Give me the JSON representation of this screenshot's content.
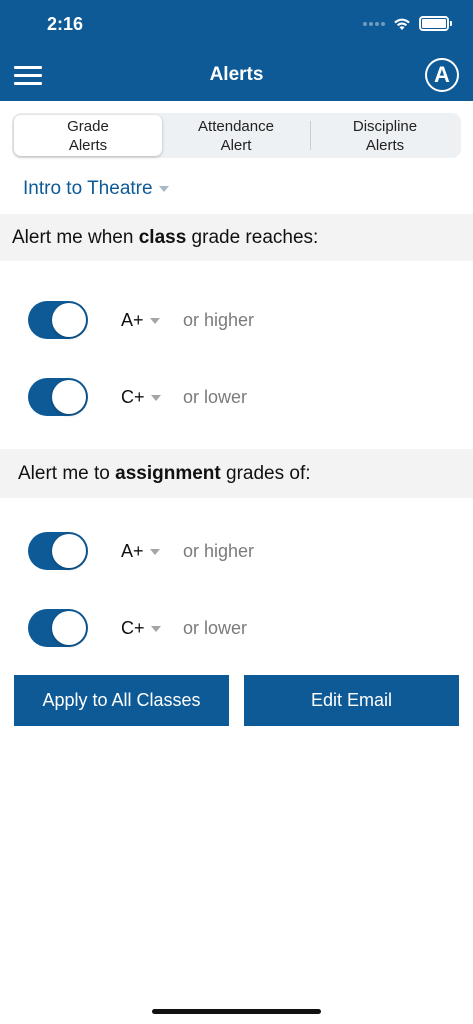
{
  "status_bar": {
    "time": "2:16"
  },
  "header": {
    "title": "Alerts",
    "account_initial": "A"
  },
  "tabs": [
    {
      "line1": "Grade",
      "line2": "Alerts",
      "active": true
    },
    {
      "line1": "Attendance",
      "line2": "Alert",
      "active": false
    },
    {
      "line1": "Discipline",
      "line2": "Alerts",
      "active": false
    }
  ],
  "class_selector": {
    "value": "Intro to Theatre"
  },
  "class_section": {
    "prefix": "Alert me when ",
    "bold": "class",
    "suffix": " grade reaches:",
    "rows": [
      {
        "grade": "A+",
        "condition": "or higher",
        "enabled": true
      },
      {
        "grade": "C+",
        "condition": "or lower",
        "enabled": true
      }
    ]
  },
  "assignment_section": {
    "prefix": "Alert me to ",
    "bold": "assignment",
    "suffix": " grades of:",
    "rows": [
      {
        "grade": "A+",
        "condition": "or higher",
        "enabled": true
      },
      {
        "grade": "C+",
        "condition": "or lower",
        "enabled": true
      }
    ]
  },
  "buttons": {
    "apply": "Apply to All Classes",
    "edit_email": "Edit Email"
  },
  "colors": {
    "primary": "#0e5a97",
    "band": "#f3f3f3",
    "muted_text": "#7b7b7b"
  }
}
